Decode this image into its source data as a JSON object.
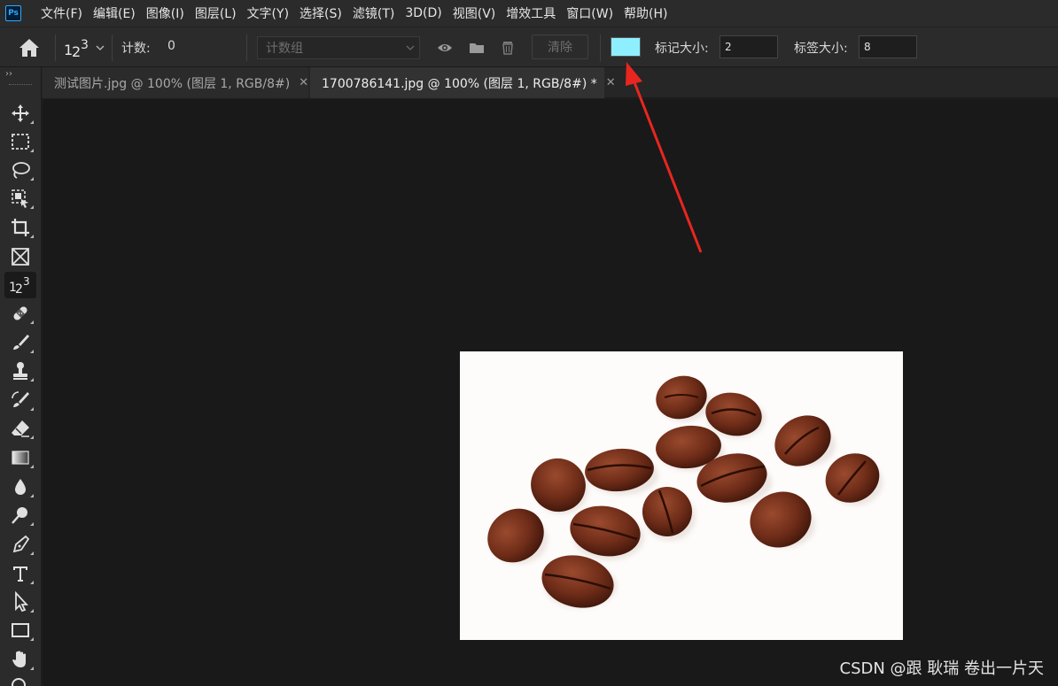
{
  "app": {
    "logo_text": "Ps",
    "menu": [
      "文件(F)",
      "编辑(E)",
      "图像(I)",
      "图层(L)",
      "文字(Y)",
      "选择(S)",
      "滤镜(T)",
      "3D(D)",
      "视图(V)",
      "增效工具",
      "窗口(W)",
      "帮助(H)"
    ]
  },
  "options_bar": {
    "count_tool_glyph": "123",
    "count_label": "计数:",
    "count_value": "0",
    "count_group_placeholder": "计数组",
    "clear_label": "清除",
    "marker_color": "#8ef0ff",
    "marker_size_label": "标记大小:",
    "marker_size_value": "2",
    "label_size_label": "标签大小:",
    "label_size_value": "8"
  },
  "tabs": [
    {
      "label": "测试图片.jpg @ 100% (图层 1, RGB/8#)",
      "active": false
    },
    {
      "label": "1700786141.jpg @ 100% (图层 1, RGB/8#) *",
      "active": true
    }
  ],
  "tools": [
    "move-icon",
    "marquee-icon",
    "lasso-icon",
    "object-select-icon",
    "crop-icon",
    "frame-icon",
    "count-icon",
    "healing-icon",
    "brush-icon",
    "stamp-icon",
    "history-brush-icon",
    "eraser-icon",
    "gradient-icon",
    "blur-icon",
    "dodge-icon",
    "pen-icon",
    "type-icon",
    "path-select-icon",
    "rectangle-icon",
    "hand-icon",
    "zoom-icon"
  ],
  "canvas": {
    "image_subject": "coffee beans",
    "background_color": "#fefcfb",
    "annotation_color": "#e8261f"
  },
  "watermark": "CSDN @跟 耿瑞 卷出一片天"
}
